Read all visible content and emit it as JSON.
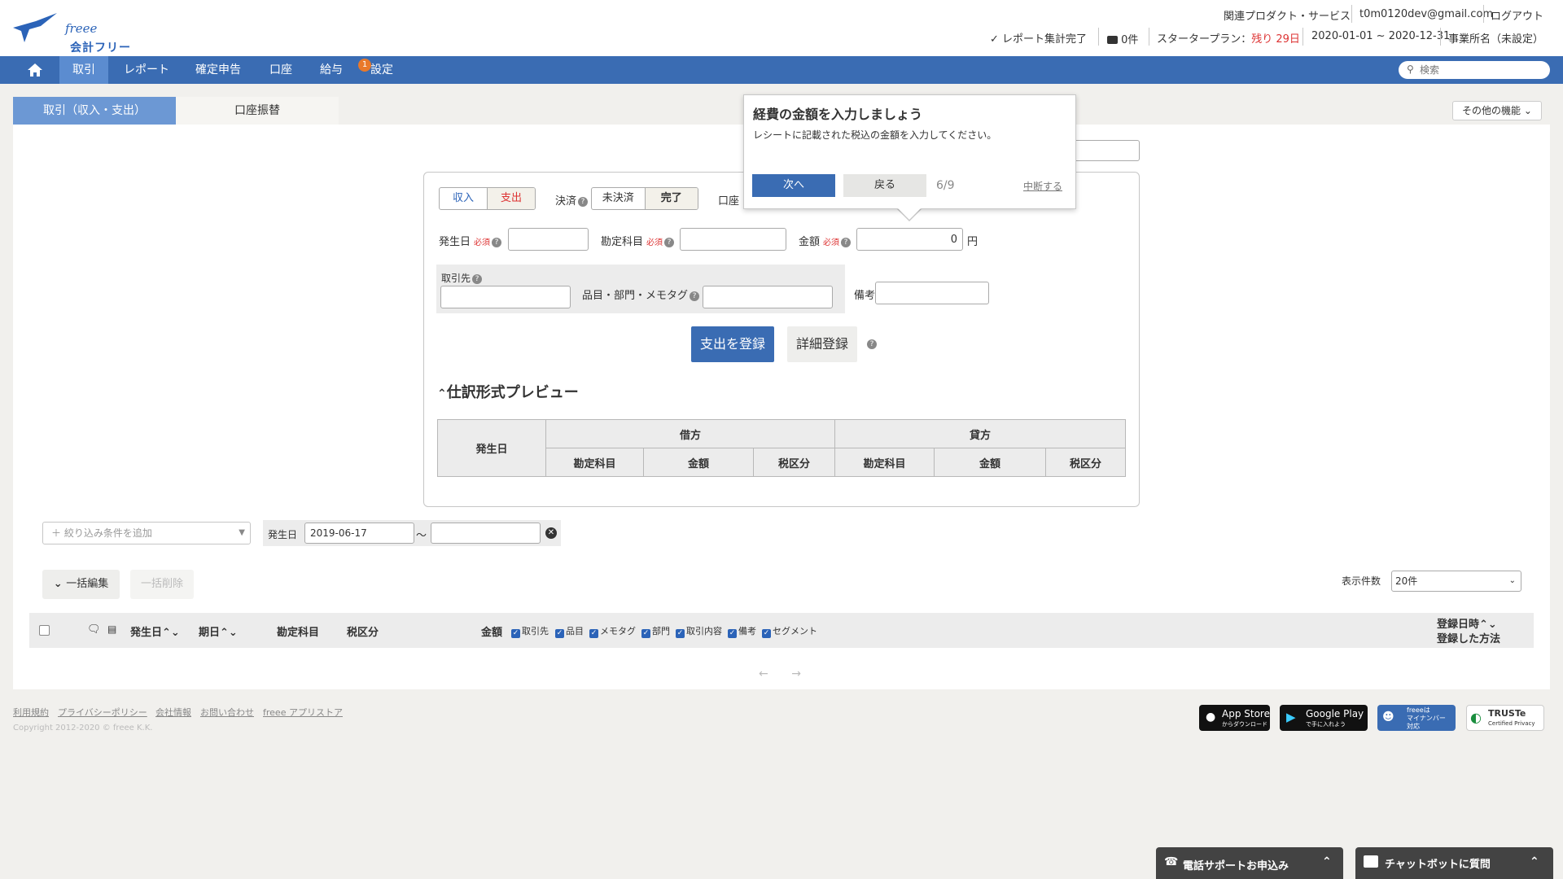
{
  "header": {
    "logo_brand": "freee",
    "logo_label": "会計フリー",
    "related_products": "関連プロダクト・サービス",
    "email": "t0m0120dev@gmail.com",
    "logout": "ログアウト",
    "report_status": "レポート集計完了",
    "messages_count": "0件",
    "plan_label": "スタータープラン：",
    "plan_remaining": "残り 29日",
    "period": "2020-01-01 ~ 2020-12-31",
    "office_name": "事業所名（未設定）"
  },
  "nav": {
    "items": [
      "取引",
      "レポート",
      "確定申告",
      "口座",
      "給与",
      "設定"
    ],
    "badge": "1",
    "search_placeholder": "検索"
  },
  "tabs": {
    "transactions": "取引（収入・支出）",
    "transfer": "口座振替",
    "other_functions": "その他の機能"
  },
  "form": {
    "type_income": "収入",
    "type_expense": "支出",
    "settlement_label": "決済",
    "unsettled": "未決済",
    "settled": "完了",
    "account_label": "口座",
    "date_label": "発生日",
    "required": "必須",
    "account_item_label": "勘定科目",
    "amount_label": "金額",
    "amount_value": "0",
    "yen": "円",
    "partner_label": "取引先",
    "item_label": "品目・部門・メモタグ",
    "memo_label": "備考",
    "register_button": "支出を登録",
    "detail_button": "詳細登録",
    "preview_title": "仕訳形式プレビュー",
    "preview_columns": {
      "date": "発生日",
      "debit": "借方",
      "credit": "貸方",
      "debit_item": "勘定科目",
      "debit_amount": "金額",
      "debit_tax": "税区分",
      "credit_item": "勘定科目",
      "credit_amount": "金額",
      "credit_tax": "税区分"
    }
  },
  "filter": {
    "add_placeholder": "＋ 絞り込み条件を追加",
    "date_label": "発生日",
    "date_from": "2019-06-17",
    "date_to": "",
    "tilde": "〜"
  },
  "list": {
    "bulk_edit": "一括編集",
    "bulk_delete": "一括削除",
    "per_page_label": "表示件数",
    "per_page_value": "20件",
    "columns": {
      "date": "発生日",
      "due": "期日",
      "account_item": "勘定科目",
      "tax": "税区分",
      "amount": "金額",
      "registered_at": "登録日時",
      "registered_by": "登録した方法"
    },
    "toggles": [
      "取引先",
      "品目",
      "メモタグ",
      "部門",
      "取引内容",
      "備考",
      "セグメント"
    ]
  },
  "footer": {
    "links": [
      "利用規約",
      "プライバシーポリシー",
      "会社情報",
      "お問い合わせ",
      "freee アプリストア"
    ],
    "copyright": "Copyright 2012-2020 © freee K.K.",
    "app_store": "App Store",
    "app_store_sub": "からダウンロード",
    "google_play": "Google Play",
    "google_play_sub": "で手に入れよう",
    "mynumber_line1": "freeeは",
    "mynumber_line2": "マイナンバー",
    "mynumber_line3": "対応",
    "truste": "TRUSTe",
    "truste_sub": "Certified Privacy"
  },
  "bottom_bar": {
    "phone_support": "電話サポートお申込み",
    "chatbot": "チャットボットに質問"
  },
  "popover": {
    "title": "経費の金額を入力しましょう",
    "description": "レシートに記載された税込の金額を入力してください。",
    "next": "次へ",
    "back": "戻る",
    "step": "6/9",
    "abort": "中断する"
  },
  "colors": {
    "brand_blue": "#3a6cb3",
    "active_tab": "#6c98d4",
    "warning_red": "#d33333",
    "badge_orange": "#e9792a"
  }
}
